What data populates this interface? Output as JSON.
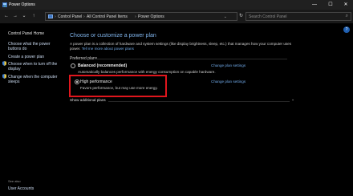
{
  "titlebar": {
    "title": "Power Options",
    "minimize": "—",
    "maximize": "☐",
    "close": "✕"
  },
  "addressbar": {
    "back": "←",
    "forward": "→",
    "recent": "⌄",
    "up": "↑",
    "crumbs": [
      "Control Panel",
      "All Control Panel Items",
      "Power Options"
    ],
    "separator": "›",
    "dropdown": "⌄",
    "refresh": "↻",
    "search_placeholder": "Search Control Panel",
    "search_icon": "⌕"
  },
  "leftpane": {
    "home": "Control Panel Home",
    "items": [
      "Choose what the power buttons do",
      "Create a power plan",
      "Choose when to turn off the display",
      "Change when the computer sleeps"
    ],
    "see_also": "See also",
    "user_accounts": "User Accounts"
  },
  "main": {
    "heading": "Choose or customize a power plan",
    "intro": "A power plan is a collection of hardware and system settings (like display brightness, sleep, etc.) that manages how your computer uses power.",
    "intro_link": "Tell me more about power plans",
    "preferred_label": "Preferred plans",
    "plans": [
      {
        "name": "Balanced (recommended)",
        "description": "Automatically balances performance with energy consumption on capable hardware.",
        "link": "Change plan settings",
        "selected": false
      },
      {
        "name": "High performance",
        "description": "Favors performance, but may use more energy.",
        "link": "Change plan settings",
        "selected": true
      }
    ],
    "show_more": "Show additional plans",
    "show_more_chevron": "⌄",
    "help": "?"
  },
  "colors": {
    "highlight": "#e0161d",
    "link": "#6fa8e6",
    "heading": "#7fb3ea"
  }
}
